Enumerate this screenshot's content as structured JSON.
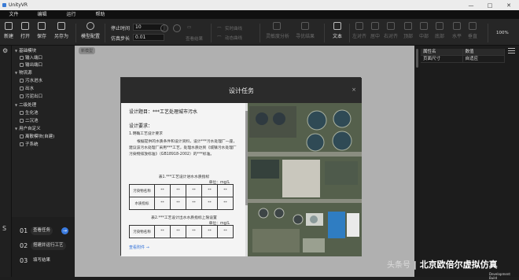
{
  "app": {
    "title": "UnityVR",
    "window_controls": [
      "—",
      "□",
      "✕"
    ]
  },
  "menu": [
    "文件",
    "编辑",
    "运行",
    "帮助"
  ],
  "toolbar": {
    "new": "新建",
    "open": "打开",
    "save": "保存",
    "save_as": "另存为",
    "model_config": "模型配置",
    "stop_time_label": "停止时间",
    "stop_time_value": "10",
    "step_label": "仿真步长",
    "step_value": "0.01",
    "view_result": "查看结果",
    "realtime_curve": "实时曲线",
    "dynamic_curve": "动态曲线",
    "sensitivity": "灵敏度分析",
    "optimize": "寻优结果",
    "text": "文本",
    "align_left": "左对齐",
    "align_center_h": "居中",
    "align_right": "右对齐",
    "align_top": "顶部",
    "align_middle": "中部",
    "align_bottom": "底部",
    "horizontal": "水平",
    "vertical": "垂直",
    "zoom": "100%"
  },
  "tree": {
    "items": [
      {
        "label": "基础模块",
        "level": 0
      },
      {
        "label": "输入端口",
        "level": 1
      },
      {
        "label": "输出端口",
        "level": 1
      },
      {
        "label": "物流源",
        "level": 0
      },
      {
        "label": "污水进水",
        "level": 1
      },
      {
        "label": "出水",
        "level": 1
      },
      {
        "label": "污泥出口",
        "level": 1
      },
      {
        "label": "二级处理",
        "level": 0
      },
      {
        "label": "生化池",
        "level": 1
      },
      {
        "label": "二沉池",
        "level": 1
      },
      {
        "label": "用户自定义",
        "level": 0
      },
      {
        "label": "离散模块(自建)",
        "level": 1
      },
      {
        "label": "子系统",
        "level": 1
      }
    ]
  },
  "tasks": [
    {
      "num": "01",
      "label": "查看任务",
      "active": true
    },
    {
      "num": "02",
      "label": "搭建并运行工艺",
      "active": false
    },
    {
      "num": "03",
      "label": "填写结果",
      "active": false
    }
  ],
  "canvas": {
    "tag": "新模型"
  },
  "properties": {
    "header": [
      "属性名",
      "数值"
    ],
    "rows": [
      [
        "页面尺寸",
        "自适应"
      ]
    ]
  },
  "modal": {
    "title": "设计任务",
    "close": "×",
    "topic_label": "设计题目：***工艺处理城市污水",
    "req_label": "设计要求：",
    "req1": "1.明确工艺设计要求",
    "para": "根据提供的水质条件和设计资料，设计***污水处理厂一座，建议该污水处理厂采用***工艺，处理水质达到《城镇污水处理厂污染物排放标准》（GB18918-2002）的***标准。",
    "table1_caption": "表1.***工艺设计进水水质指标",
    "table1_unit": "单位：mg/L",
    "table1_rows": [
      [
        "污染物名称",
        "**",
        "**",
        "**",
        "**",
        "**"
      ],
      [
        "水质指标",
        "**",
        "**",
        "**",
        "**",
        "**"
      ]
    ],
    "table2_caption": "表2.***工艺设计出水水质指标上限设置",
    "table2_unit": "单位：mg/L",
    "table2_rows": [
      [
        "污染物名称",
        "**",
        "**",
        "**",
        "**",
        "**"
      ],
      [
        "",
        "**",
        "**",
        "**",
        "**",
        "**"
      ]
    ],
    "link": "查看附件 →"
  },
  "watermark": {
    "prefix": "头条号",
    "brand": "北京欧倍尔虚拟仿真",
    "sub": "Development Build"
  }
}
